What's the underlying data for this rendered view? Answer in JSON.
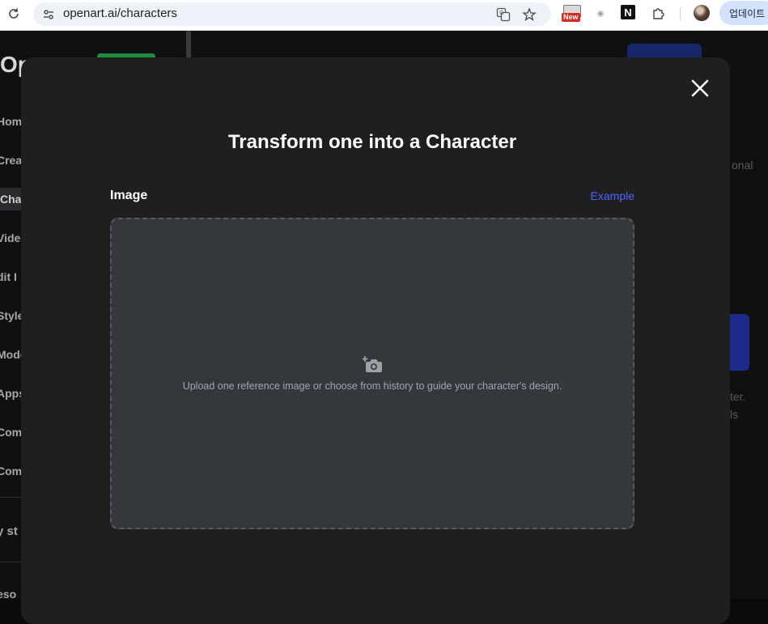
{
  "browser": {
    "url": "openart.ai/characters",
    "new_badge_label": "New",
    "notion_label": "N",
    "update_button_label": "업데이트"
  },
  "background": {
    "logo_text": "Op",
    "sidebar_items": [
      "Home",
      "Crea",
      "Char",
      "Vide",
      "dit I",
      "Style",
      "Mode",
      "Apps",
      "Com",
      "Com"
    ],
    "sidebar_lower": [
      "y st",
      "eso"
    ],
    "right_text": [
      "onal",
      "ter.",
      "ls"
    ]
  },
  "modal": {
    "title": "Transform one into a Character",
    "image_label": "Image",
    "example_link": "Example",
    "upload_hint": "Upload one reference image or choose from history to guide your character's design.",
    "close_icon": "close-icon",
    "upload_icon": "camera-add-icon"
  },
  "colors": {
    "modal_bg": "#1f1f20",
    "dropzone_bg": "#36373b",
    "accent_link": "#4f63ff"
  }
}
